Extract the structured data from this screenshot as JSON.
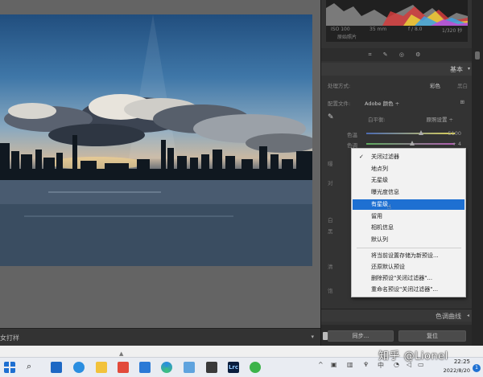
{
  "photo": {
    "alt": ""
  },
  "filmstrip": {
    "label": "女打样",
    "arrow": "▾"
  },
  "panel": {
    "camera_info": {
      "iso": "ISO 100",
      "focal": "35 mm",
      "aperture": "f / 8.0",
      "shutter": "1/320 秒"
    },
    "original_photo": "原始照片",
    "tool_strip": "⌗ ✎ ◎ ⚙",
    "basic": {
      "title": "基本",
      "arrow": "▾"
    },
    "treatment": {
      "label": "处理方式:",
      "option_color": "彩色",
      "option_bw": "黑白"
    },
    "profile": {
      "label": "配置文件:",
      "value": "Adobe 颜色 ÷",
      "grid_icon": "⊞"
    },
    "white_balance": {
      "label": "白平衡:",
      "value": "原照设置 ÷"
    },
    "temperature": {
      "label": "色温",
      "value": "5100",
      "position": 0.62
    },
    "tint": {
      "label": "色调",
      "value": "+ 4",
      "position": 0.52
    },
    "tone_curve": {
      "title": "色调曲线",
      "arrow": "◂"
    },
    "sync_button": "同步...",
    "reset_button": "复位"
  },
  "context_menu": {
    "items": [
      {
        "label": "关闭过滤器",
        "checked": true
      },
      {
        "label": "地点列",
        "checked": false
      },
      {
        "label": "无星级",
        "checked": false
      },
      {
        "label": "曝光度信息",
        "checked": false
      },
      {
        "label": "有星级",
        "checked": false,
        "active": true
      },
      {
        "label": "留用",
        "checked": false
      },
      {
        "label": "相机信息",
        "checked": false
      },
      {
        "label": "默认列",
        "checked": false
      }
    ],
    "preset_items": [
      {
        "label": "将当前设置存储为新预设..."
      },
      {
        "label": "还原默认预设"
      },
      {
        "label": "删除预设\"关闭过滤器\"..."
      },
      {
        "label": "重命名预设\"关闭过滤器\"..."
      }
    ]
  },
  "taskbar": {
    "time": "22:25",
    "date": "2022/8/20",
    "tray_lang": "中",
    "notification_count": "1",
    "lrc_label": "Lrc",
    "search_icon": "⌕"
  },
  "watermark": "知乎 @Lionel",
  "icons": {
    "search": "search-icon",
    "mail": "mail-icon",
    "weather": "weather-icon",
    "folder": "folder-icon",
    "store": "store-icon",
    "edge": "edge-browser-icon",
    "photos": "photos-icon",
    "wechat": "wechat-icon"
  },
  "colors": {
    "menu_highlight": "#1e70d2",
    "panel_bg": "#333333",
    "taskbar_bg": "#e9ecf2"
  }
}
